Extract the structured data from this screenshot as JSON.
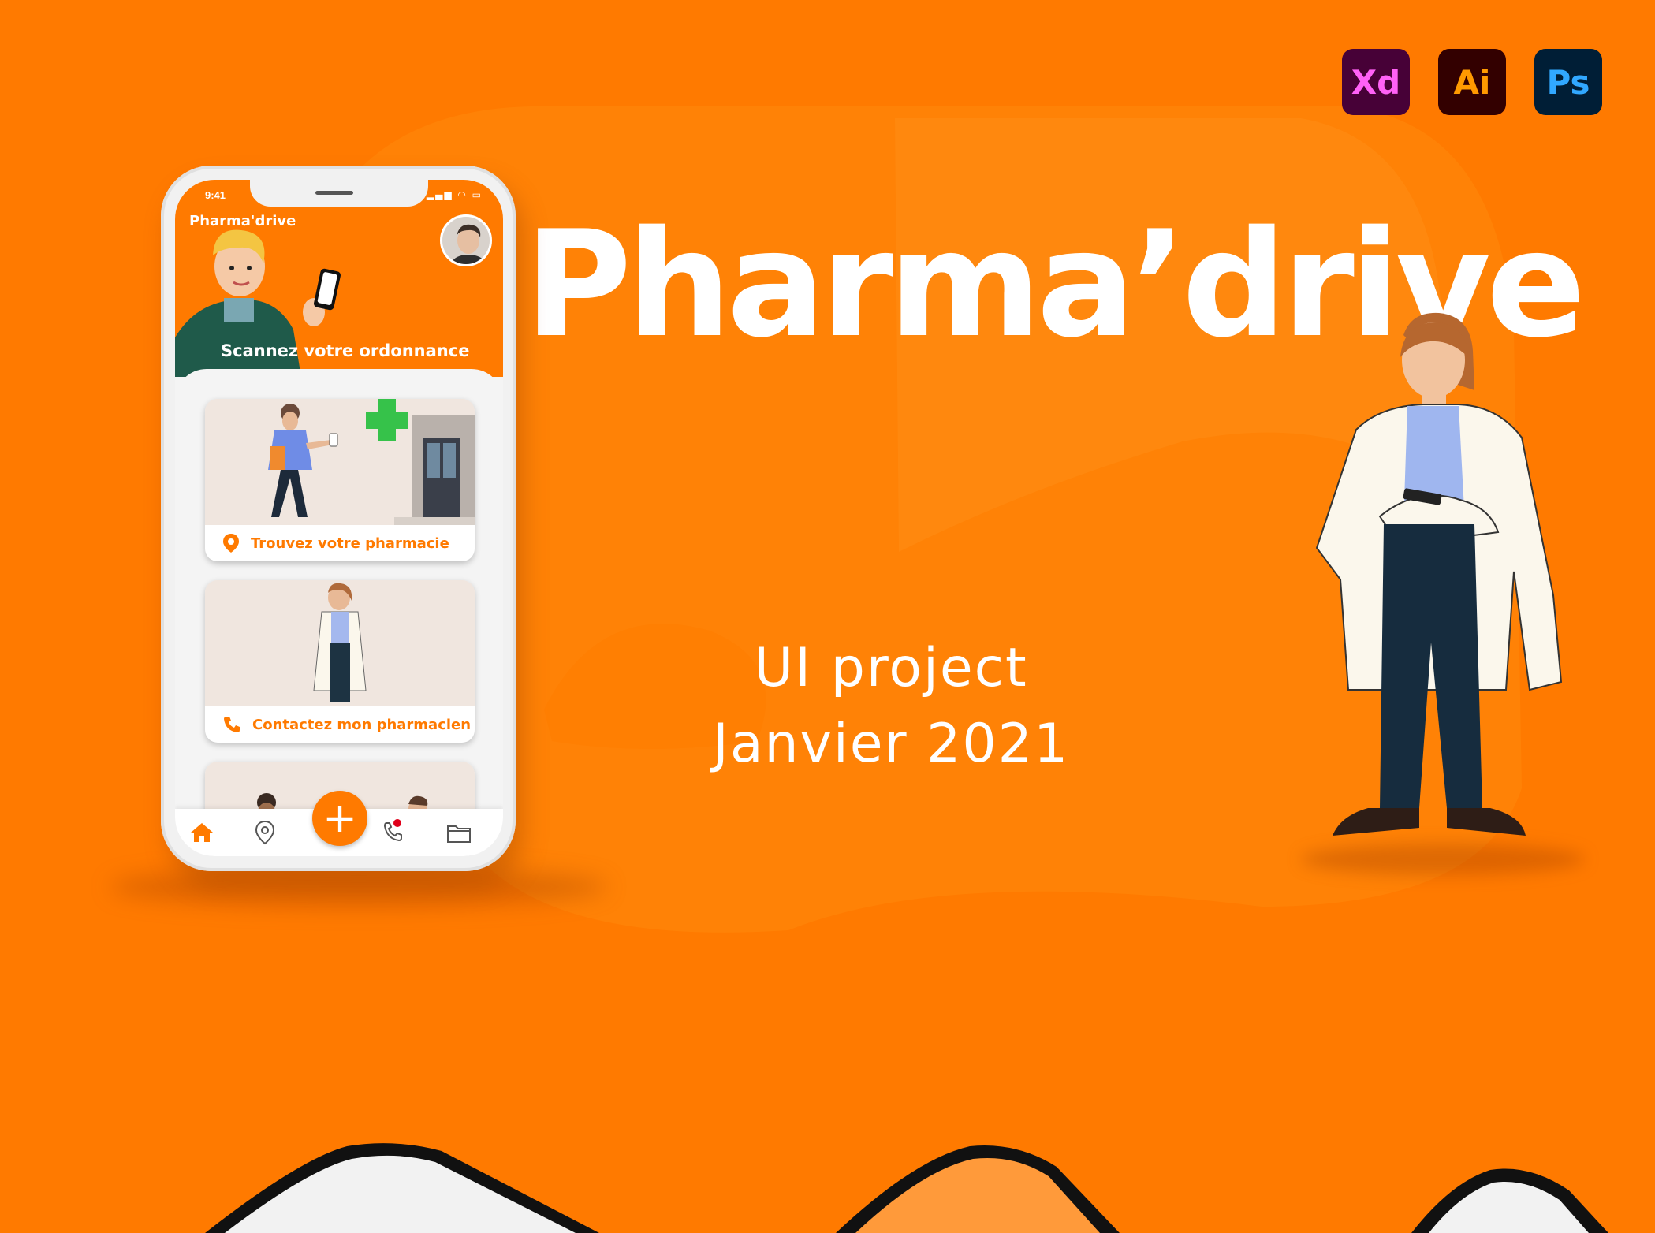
{
  "hero": {
    "title": "Pharma’drive",
    "subtitle_line1": "UI project",
    "subtitle_line2": "Janvier 2021"
  },
  "tools": [
    "Xd",
    "Ai",
    "Ps"
  ],
  "phone": {
    "status_time": "9:41",
    "status_icons": "▂▄▆ ◠ ▭",
    "app_name": "Pharma'drive",
    "scan_label": "Scannez votre ordonnance",
    "cards": [
      {
        "label": "Trouvez votre pharmacie",
        "icon": "location-pin-icon"
      },
      {
        "label": "Contactez mon pharmacien",
        "icon": "phone-icon"
      }
    ],
    "tabbar": [
      "home-icon",
      "location-icon",
      "plus-icon",
      "phone-call-icon",
      "folder-icon"
    ],
    "fab_symbol": "+"
  },
  "colors": {
    "brand_orange": "#ff7a00",
    "card_bg": "#f0e6df",
    "notification_dot": "#e0001a"
  }
}
